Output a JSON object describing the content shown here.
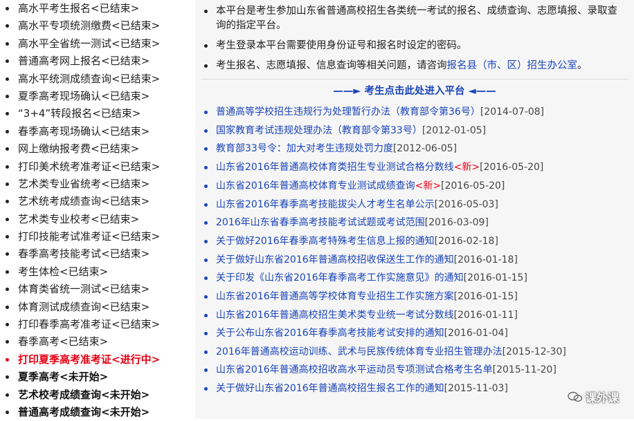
{
  "left_menu": [
    {
      "label": "高水平考生报名<已结束>",
      "state": "ended"
    },
    {
      "label": "高水平专项统测缴费<已结束>",
      "state": "ended"
    },
    {
      "label": "高水平全省统一测试<已结束>",
      "state": "ended"
    },
    {
      "label": "普通高考网上报名<已结束>",
      "state": "ended"
    },
    {
      "label": "高水平统测成绩查询<已结束>",
      "state": "ended"
    },
    {
      "label": "夏季高考现场确认<已结束>",
      "state": "ended"
    },
    {
      "label": "“3+4”转段报名<已结束>",
      "state": "ended"
    },
    {
      "label": "春季高考现场确认<已结束>",
      "state": "ended"
    },
    {
      "label": "网上缴纳报考费<已结束>",
      "state": "ended"
    },
    {
      "label": "打印美术统考准考证<已结束>",
      "state": "ended"
    },
    {
      "label": "艺术类专业省统考<已结束>",
      "state": "ended"
    },
    {
      "label": "艺术统考成绩查询<已结束>",
      "state": "ended"
    },
    {
      "label": "艺术类专业校考<已结束>",
      "state": "ended"
    },
    {
      "label": "打印技能考试准考证<已结束>",
      "state": "ended"
    },
    {
      "label": "春季高考技能考试<已结束>",
      "state": "ended"
    },
    {
      "label": "考生体检<已结束>",
      "state": "ended"
    },
    {
      "label": "体育类省统一测试<已结束>",
      "state": "ended"
    },
    {
      "label": "体育测试成绩查询<已结束>",
      "state": "ended"
    },
    {
      "label": "打印春季高考准考证<已结束>",
      "state": "ended"
    },
    {
      "label": "春季高考<已结束>",
      "state": "ended"
    },
    {
      "label": "打印夏季高考准考证<进行中>",
      "state": "active"
    },
    {
      "label": "夏季高考<未开始>",
      "state": "pending"
    },
    {
      "label": "艺术校考成绩查询<未开始>",
      "state": "pending"
    },
    {
      "label": "普通高考成绩查询<未开始>",
      "state": "pending"
    }
  ],
  "notices": [
    {
      "text": "本平台是考生参加山东省普通高校招生各类统一考试的报名、成绩查询、志愿填报、录取查询的指定平台。",
      "link": ""
    },
    {
      "text": "考生登录本平台需要使用身份证号和报名时设定的密码。",
      "link": ""
    },
    {
      "text": "考生报名、志愿填报、信息查询等相关问题，请咨询",
      "link": "报名县（市、区）招生办公室",
      "tail": "。"
    }
  ],
  "enter_platform": {
    "arrow_left": "——►",
    "label": "考生点击此处进入平台",
    "arrow_right": "◄——"
  },
  "links": [
    {
      "title": "普通高等学校招生违规行为处理暂行办法（教育部令第36号）",
      "new": "",
      "date": "[2014-07-08]"
    },
    {
      "title": "国家教育考试违规处理办法（教育部令第33号）",
      "new": "",
      "date": "[2012-01-05]"
    },
    {
      "title": "教育部33号令：加大对考生违规处罚力度",
      "new": "",
      "date": "[2012-06-05]"
    },
    {
      "title": "山东省2016年普通高校体育类招生专业测试合格分数线",
      "new": "<新>",
      "date": "[2016-05-20]"
    },
    {
      "title": "山东省2016年普通高校体育专业测试成绩查询",
      "new": "<新>",
      "date": "[2016-05-20]"
    },
    {
      "title": "山东省2016年春季高考技能拔尖人才考生名单公示",
      "new": "",
      "date": "[2016-05-03]"
    },
    {
      "title": "2016年山东省春季高考技能考试试题或考试范围",
      "new": "",
      "date": "[2016-03-09]"
    },
    {
      "title": "关于做好2016年春季高考特殊考生信息上报的通知",
      "new": "",
      "date": "[2016-02-18]"
    },
    {
      "title": "关于做好山东省2016年普通高校招收保送生工作的通知",
      "new": "",
      "date": "[2016-01-18]"
    },
    {
      "title": "关于印发《山东省2016年春季高考工作实施意见》的通知",
      "new": "",
      "date": "[2016-01-15]"
    },
    {
      "title": "山东省2016年普通高等学校体育专业招生工作实施方案",
      "new": "",
      "date": "[2016-01-15]"
    },
    {
      "title": "山东省2016年普通高校招生美术类专业统一考试分数线",
      "new": "",
      "date": "[2016-01-11]"
    },
    {
      "title": "关于公布山东省2016年春季高考技能考试安排的通知",
      "new": "",
      "date": "[2016-01-04]"
    },
    {
      "title": "2016年普通高校运动训练、武术与民族传统体育专业招生管理办法",
      "new": "",
      "date": "[2015-12-30]"
    },
    {
      "title": "山东省2016年普通高校招收高水平运动员专项测试合格考生名单",
      "new": "",
      "date": "[2015-11-20]"
    },
    {
      "title": "关于做好山东省2016年普通高校招生报名工作的通知",
      "new": "",
      "date": "[2015-11-03]"
    }
  ],
  "watermark": {
    "text": "课外课",
    "icon": "wechat-icon"
  },
  "colors": {
    "link": "#1a44b8",
    "active": "#e60012"
  }
}
